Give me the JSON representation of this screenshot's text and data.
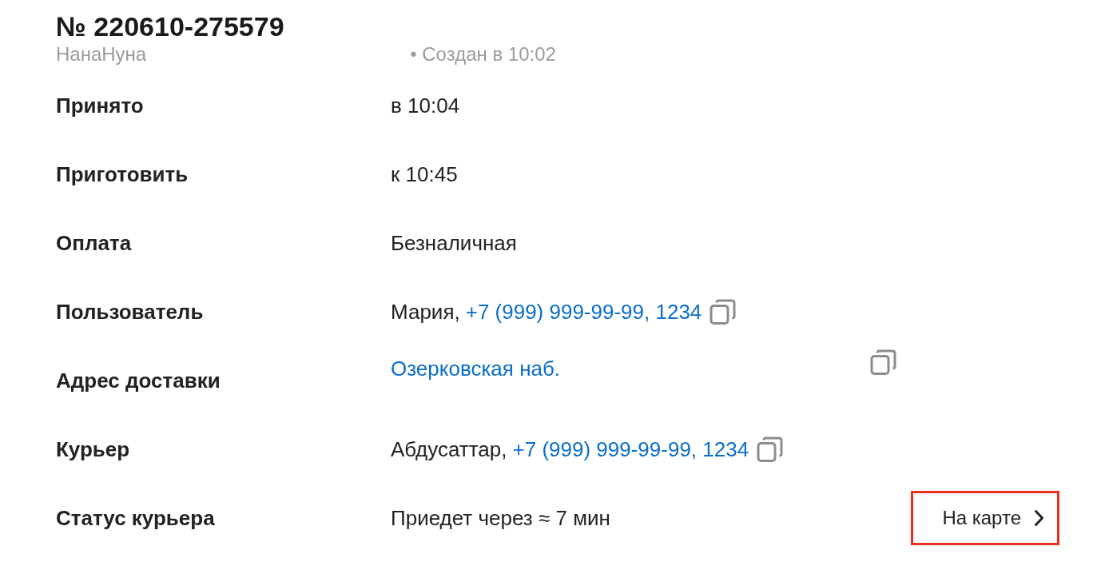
{
  "order": {
    "number": "№ 220610-275579",
    "restaurant": "НанаНуна",
    "created": "• Создан в 10:02"
  },
  "details": [
    {
      "label": "Принято",
      "kind": "text",
      "value": "в 10:04"
    },
    {
      "label": "Приготовить",
      "kind": "text",
      "value": "к 10:45"
    },
    {
      "label": "Оплата",
      "kind": "text",
      "value": "Безналичная"
    },
    {
      "label": "Пользователь",
      "kind": "contact",
      "name": "Мария,",
      "phone": "+7 (999) 999-99-99, 1234"
    },
    {
      "label": "Адрес доставки",
      "kind": "address",
      "link": "Озерковская наб."
    },
    {
      "label": "Курьер",
      "kind": "contact",
      "name": "Абдусаттар,",
      "phone": "+7 (999) 999-99-99, 1234"
    },
    {
      "label": "Статус курьера",
      "kind": "status",
      "value": "Приедет через ≈ 7 мин",
      "action": {
        "label": "На карте",
        "highlighted": true
      }
    }
  ]
}
